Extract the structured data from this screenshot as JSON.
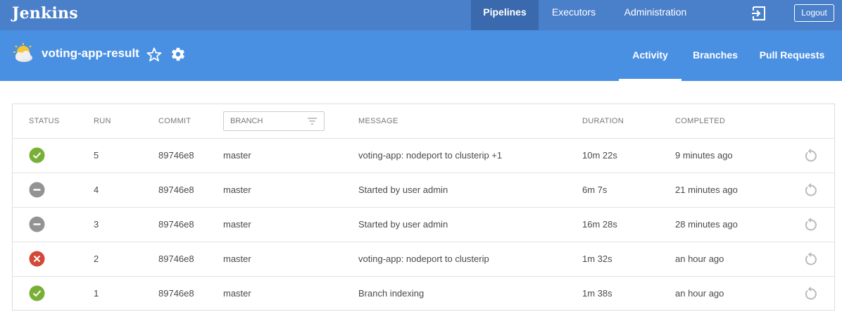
{
  "header": {
    "logo": "Jenkins",
    "nav": [
      {
        "label": "Pipelines",
        "active": true
      },
      {
        "label": "Executors",
        "active": false
      },
      {
        "label": "Administration",
        "active": false
      }
    ],
    "logout_label": "Logout"
  },
  "pipeline": {
    "name": "voting-app-result",
    "tabs": [
      {
        "label": "Activity",
        "active": true
      },
      {
        "label": "Branches",
        "active": false
      },
      {
        "label": "Pull Requests",
        "active": false
      }
    ]
  },
  "table": {
    "headers": {
      "status": "STATUS",
      "run": "RUN",
      "commit": "COMMIT",
      "branch": "BRANCH",
      "message": "MESSAGE",
      "duration": "DURATION",
      "completed": "COMPLETED"
    },
    "rows": [
      {
        "status": "success",
        "run": "5",
        "commit": "89746e8",
        "branch": "master",
        "message": "voting-app: nodeport to clusterip +1",
        "duration": "10m 22s",
        "completed": "9 minutes ago"
      },
      {
        "status": "aborted",
        "run": "4",
        "commit": "89746e8",
        "branch": "master",
        "message": "Started by user admin",
        "duration": "6m 7s",
        "completed": "21 minutes ago"
      },
      {
        "status": "aborted",
        "run": "3",
        "commit": "89746e8",
        "branch": "master",
        "message": "Started by user admin",
        "duration": "16m 28s",
        "completed": "28 minutes ago"
      },
      {
        "status": "failure",
        "run": "2",
        "commit": "89746e8",
        "branch": "master",
        "message": "voting-app: nodeport to clusterip",
        "duration": "1m 32s",
        "completed": "an hour ago"
      },
      {
        "status": "success",
        "run": "1",
        "commit": "89746e8",
        "branch": "master",
        "message": "Branch indexing",
        "duration": "1m 38s",
        "completed": "an hour ago"
      }
    ]
  },
  "colors": {
    "topbar": "#4a7fc9",
    "subbar": "#4a90e2",
    "success": "#78b037",
    "failure": "#d24939",
    "aborted": "#949393"
  },
  "icons": {
    "health": "partly-cloudy-weather-icon",
    "favorite": "star-outline-icon",
    "settings": "gear-icon",
    "exit": "sign-out-icon",
    "filter": "filter-icon",
    "replay": "replay-icon"
  }
}
